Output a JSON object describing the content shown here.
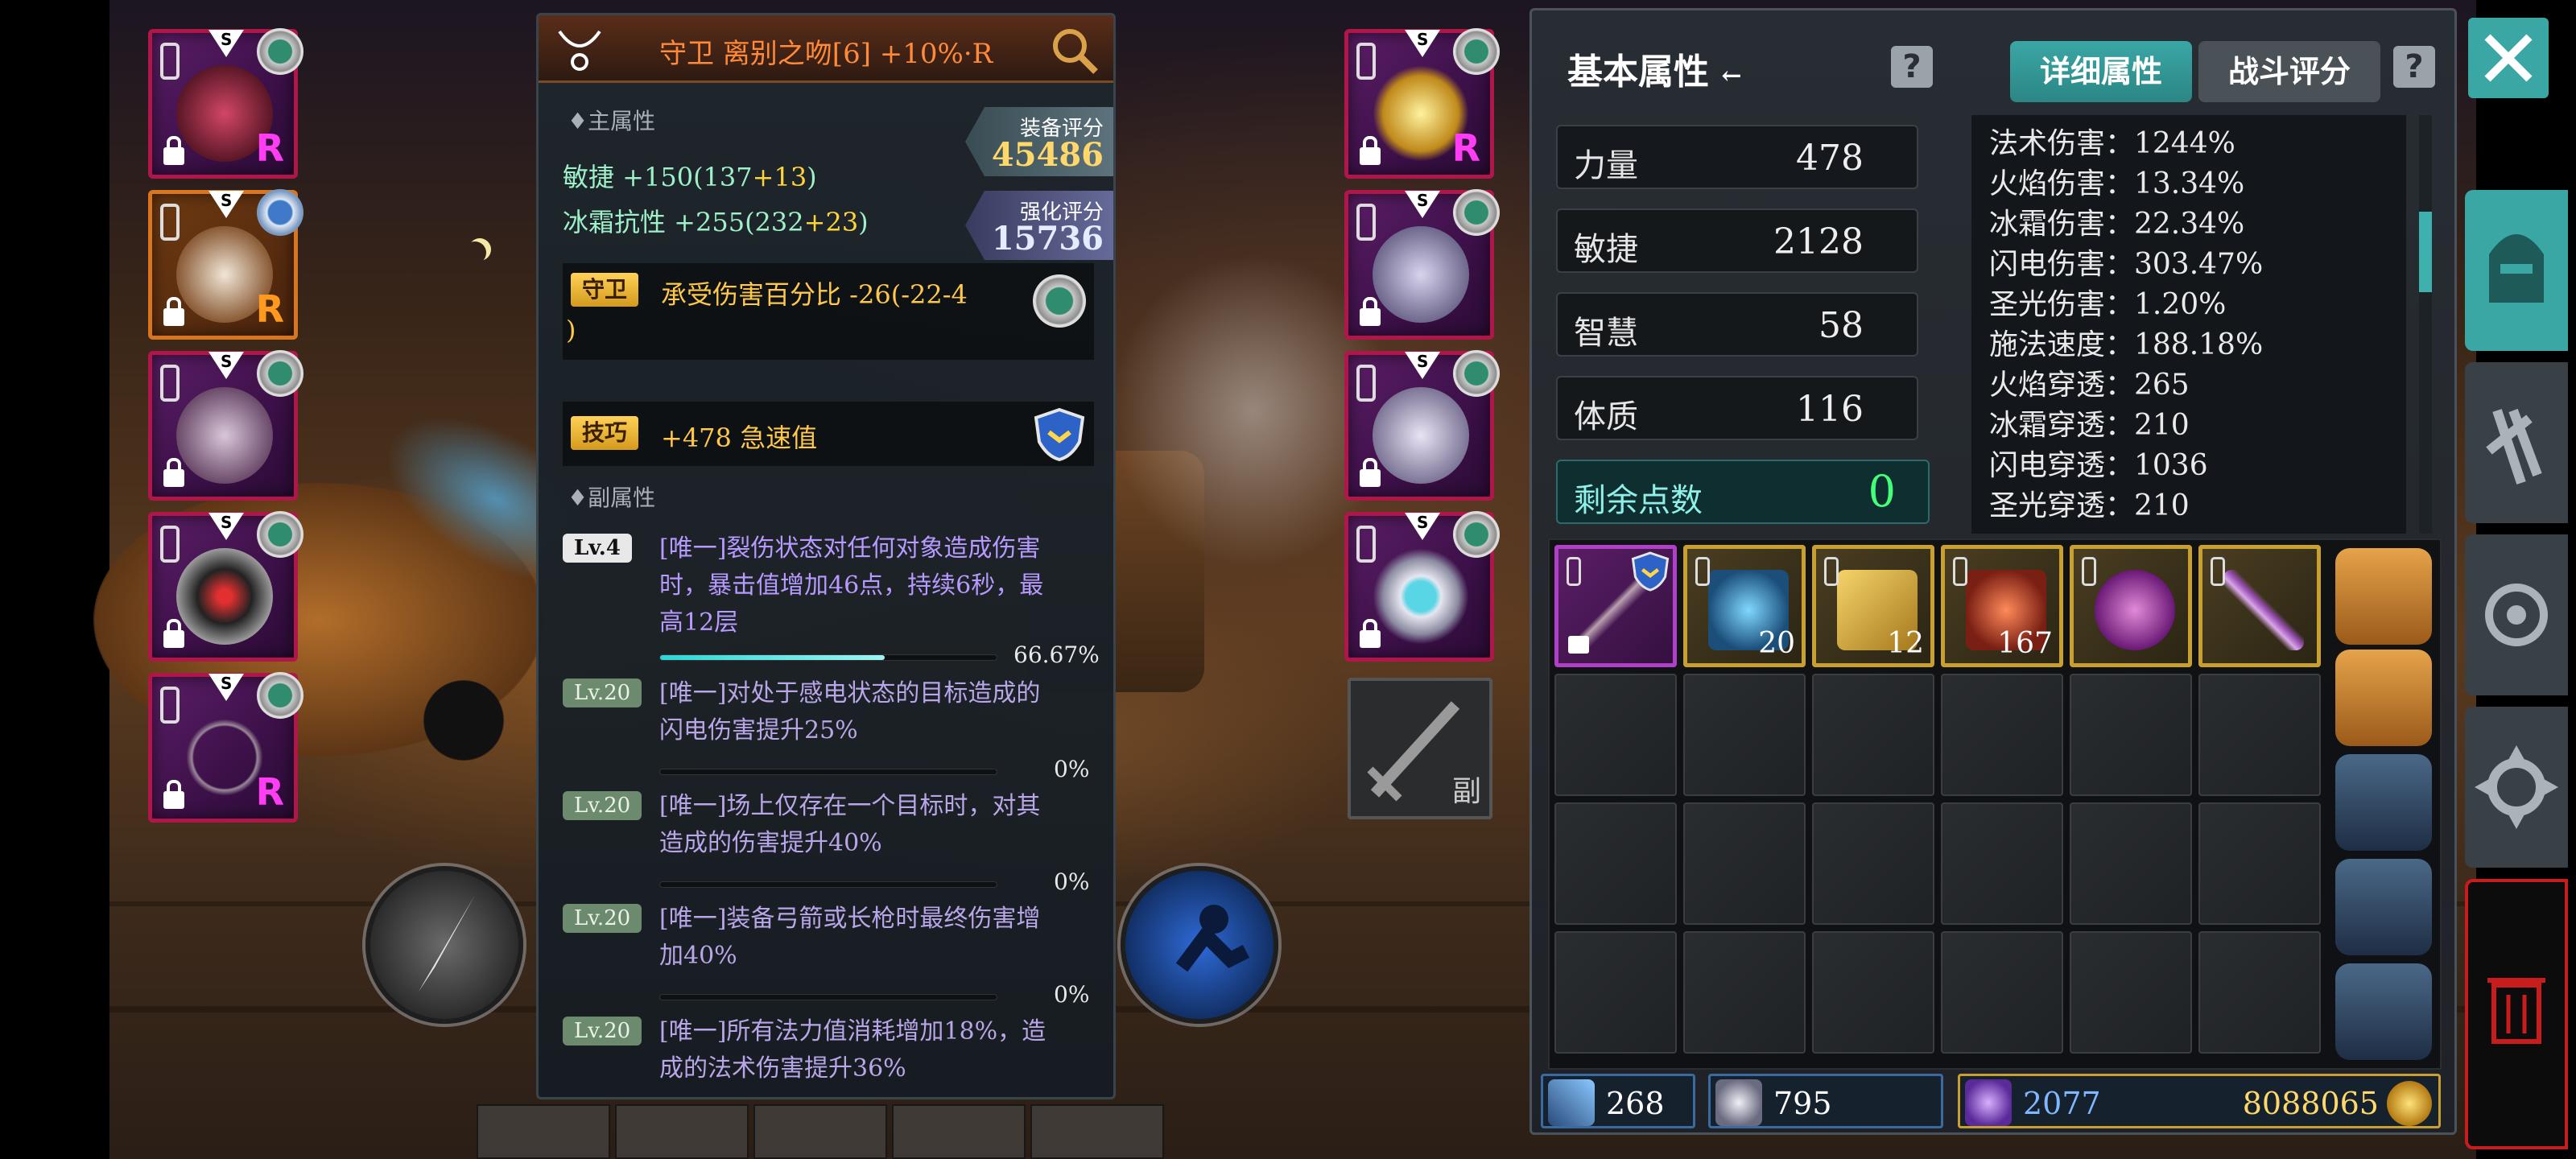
{
  "left_equipment": [
    {
      "name": "helmet-slot",
      "rank": "S",
      "tier": "R",
      "frame": "red"
    },
    {
      "name": "armor-slot",
      "rank": "S",
      "tier": "R",
      "frame": "orange"
    },
    {
      "name": "pants-slot",
      "rank": "S",
      "tier": "",
      "frame": "red"
    },
    {
      "name": "shoulder-slot",
      "rank": "S",
      "tier": "",
      "frame": "red"
    },
    {
      "name": "bow-slot",
      "rank": "S",
      "tier": "R",
      "frame": "red"
    }
  ],
  "right_equipment": [
    {
      "name": "necklace-slot",
      "rank": "S",
      "tier": "R"
    },
    {
      "name": "gloves-slot",
      "rank": "S",
      "tier": ""
    },
    {
      "name": "boots-slot",
      "rank": "S",
      "tier": ""
    },
    {
      "name": "ring-slot",
      "rank": "S",
      "tier": ""
    }
  ],
  "offhand_slot": {
    "label": "副"
  },
  "item_detail": {
    "title": "守卫 离别之吻[6] +10%·R",
    "main_attr_label": "♦主属性",
    "main_stats": [
      {
        "base": "敏捷 +150(137",
        "bonus": "+13",
        "close": ")"
      },
      {
        "base": "冰霜抗性 +255(232",
        "bonus": "+23",
        "close": ")"
      }
    ],
    "gear_score": {
      "label": "装备评分",
      "value": "45486"
    },
    "enhance_score": {
      "label": "强化评分",
      "value": "15736"
    },
    "guard_effect": {
      "badge": "守卫",
      "text_line1": "承受伤害百分比 -26(-22-4",
      "text_line2": ")"
    },
    "skill_effect": {
      "badge": "技巧",
      "text": "+478 急速值"
    },
    "sub_attr_label": "♦副属性",
    "sub_affixes": [
      {
        "level": "Lv.4",
        "line1": "[唯一]裂伤状态对任何对象造成伤害",
        "line2": "时，暴击值增加46点，持续6秒，最",
        "line3": "高12层",
        "progress": "66.67%",
        "fill": 0.6667
      },
      {
        "level": "Lv.20",
        "line1": "[唯一]对处于感电状态的目标造成的",
        "line2": "闪电伤害提升25%",
        "line3": "",
        "progress": "0%",
        "fill": 0
      },
      {
        "level": "Lv.20",
        "line1": "[唯一]场上仅存在一个目标时，对其",
        "line2": "造成的伤害提升40%",
        "line3": "",
        "progress": "0%",
        "fill": 0
      },
      {
        "level": "Lv.20",
        "line1": "[唯一]装备弓箭或长枪时最终伤害增",
        "line2": "加40%",
        "line3": "",
        "progress": "0%",
        "fill": 0
      },
      {
        "level": "Lv.20",
        "line1": "[唯一]所有法力值消耗增加18%，造",
        "line2": "成的法术伤害提升36%",
        "line3": "",
        "progress": "0%",
        "fill": 0
      }
    ]
  },
  "attributes": {
    "title": "基本属性",
    "title_arrow": "←",
    "tabs": [
      {
        "label": "详细属性",
        "active": true
      },
      {
        "label": "战斗评分",
        "active": false
      }
    ],
    "base": [
      {
        "label": "力量",
        "value": "478"
      },
      {
        "label": "敏捷",
        "value": "2128"
      },
      {
        "label": "智慧",
        "value": "58"
      },
      {
        "label": "体质",
        "value": "116"
      }
    ],
    "remaining_points": {
      "label": "剩余点数",
      "value": "0"
    },
    "detailed": [
      "法术伤害：1244%",
      "火焰伤害：13.34%",
      "冰霜伤害：22.34%",
      "闪电伤害：303.47%",
      "圣光伤害：1.20%",
      "施法速度：188.18%",
      "火焰穿透：265",
      "冰霜穿透：210",
      "闪电穿透：1036",
      "圣光穿透：210"
    ]
  },
  "inventory": {
    "items": [
      {
        "name": "spear-item",
        "qty": "",
        "frame": "purple"
      },
      {
        "name": "crystal-item",
        "qty": "20",
        "frame": "gold"
      },
      {
        "name": "scroll-item",
        "qty": "12",
        "frame": "gold"
      },
      {
        "name": "ore-item",
        "qty": "167",
        "frame": "gold"
      },
      {
        "name": "potion-item",
        "qty": "",
        "frame": "gold"
      },
      {
        "name": "dagger-item",
        "qty": "",
        "frame": "gold"
      }
    ]
  },
  "resources": {
    "sword_shards": "268",
    "gems": "795",
    "crystals": "2077",
    "gold": "8088065"
  },
  "colors": {
    "accent_teal": "#3aa7a5",
    "score_gold": "#ffd76a",
    "affix_purple": "#b79aff",
    "main_stat_green": "#9ef0c8",
    "trash_red": "#c91c1c"
  }
}
